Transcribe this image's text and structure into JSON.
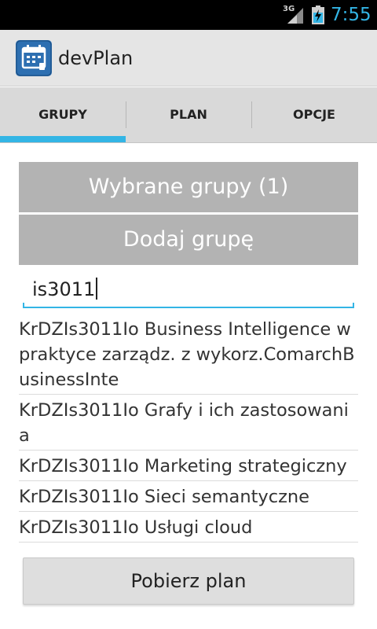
{
  "status_bar": {
    "network_label": "3G",
    "network_icon": "signal-icon",
    "battery_icon": "battery-charging-icon",
    "time": "7:55",
    "time_color": "#33b5e5"
  },
  "action_bar": {
    "app_icon": "calendar-icon",
    "title": "devPlan"
  },
  "tabs": [
    {
      "label": "GRUPY",
      "selected": true
    },
    {
      "label": "PLAN",
      "selected": false
    },
    {
      "label": "OPCJE",
      "selected": false
    }
  ],
  "accent_color": "#33b5e5",
  "main": {
    "selected_groups_label": "Wybrane grupy (1)",
    "add_group_label": "Dodaj grupę",
    "search_value": "is3011",
    "results": [
      "KrDZIs3011Io Business Intelligence w praktyce zarządz. z wykorz.ComarchBusinessInte",
      "KrDZIs3011Io Grafy i ich zastosowania",
      "KrDZIs3011Io Marketing strategiczny",
      "KrDZIs3011Io Sieci semantyczne",
      "KrDZIs3011Io Usługi cloud"
    ],
    "download_button_label": "Pobierz plan"
  }
}
